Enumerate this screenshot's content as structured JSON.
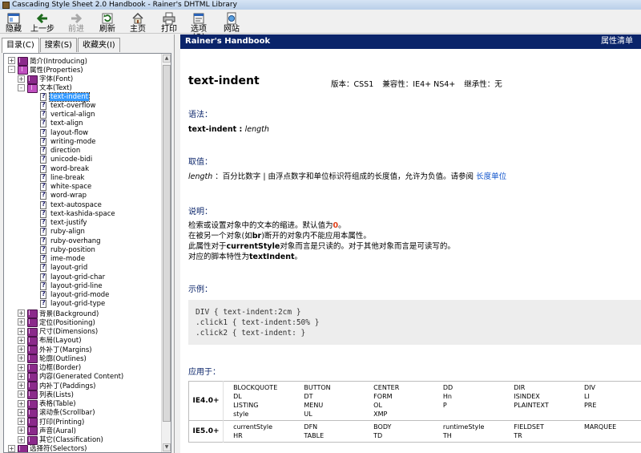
{
  "window": {
    "title": "Cascading Style Sheet 2.0 Handbook - Rainer's DHTML Library"
  },
  "toolbar": [
    {
      "id": "hide",
      "label": "隐藏",
      "icon": "hide-icon",
      "enabled": true
    },
    {
      "id": "back",
      "label": "上一步",
      "icon": "back-arrow-icon",
      "enabled": true
    },
    {
      "id": "forward",
      "label": "前进",
      "icon": "forward-arrow-icon",
      "enabled": false
    },
    {
      "id": "refresh",
      "label": "刷新",
      "icon": "refresh-icon",
      "enabled": true
    },
    {
      "id": "home",
      "label": "主页",
      "icon": "home-icon",
      "enabled": true
    },
    {
      "id": "print",
      "label": "打印",
      "icon": "printer-icon",
      "enabled": true
    },
    {
      "id": "options",
      "label": "选项(O)",
      "icon": "options-icon",
      "enabled": true
    },
    {
      "id": "web",
      "label": "网站",
      "icon": "web-icon",
      "enabled": true
    }
  ],
  "nav_tabs": [
    "目录(C)",
    "搜索(S)",
    "收藏夹(I)"
  ],
  "tree": [
    {
      "level": 0,
      "kind": "book",
      "expander": "+",
      "label": "简介(Introducing)"
    },
    {
      "level": 0,
      "kind": "book-open",
      "expander": "-",
      "label": "属性(Properties)"
    },
    {
      "level": 1,
      "kind": "book",
      "expander": "+",
      "label": "字体(Font)"
    },
    {
      "level": 1,
      "kind": "book-open",
      "expander": "-",
      "label": "文本(Text)"
    },
    {
      "level": 2,
      "kind": "page",
      "label": "text-indent",
      "selected": true
    },
    {
      "level": 2,
      "kind": "page",
      "label": "text-overflow"
    },
    {
      "level": 2,
      "kind": "page",
      "label": "vertical-align"
    },
    {
      "level": 2,
      "kind": "page",
      "label": "text-align"
    },
    {
      "level": 2,
      "kind": "page",
      "label": "layout-flow"
    },
    {
      "level": 2,
      "kind": "page",
      "label": "writing-mode"
    },
    {
      "level": 2,
      "kind": "page",
      "label": "direction"
    },
    {
      "level": 2,
      "kind": "page",
      "label": "unicode-bidi"
    },
    {
      "level": 2,
      "kind": "page",
      "label": "word-break"
    },
    {
      "level": 2,
      "kind": "page",
      "label": "line-break"
    },
    {
      "level": 2,
      "kind": "page",
      "label": "white-space"
    },
    {
      "level": 2,
      "kind": "page",
      "label": "word-wrap"
    },
    {
      "level": 2,
      "kind": "page",
      "label": "text-autospace"
    },
    {
      "level": 2,
      "kind": "page",
      "label": "text-kashida-space"
    },
    {
      "level": 2,
      "kind": "page",
      "label": "text-justify"
    },
    {
      "level": 2,
      "kind": "page",
      "label": "ruby-align"
    },
    {
      "level": 2,
      "kind": "page",
      "label": "ruby-overhang"
    },
    {
      "level": 2,
      "kind": "page",
      "label": "ruby-position"
    },
    {
      "level": 2,
      "kind": "page",
      "label": "ime-mode"
    },
    {
      "level": 2,
      "kind": "page",
      "label": "layout-grid"
    },
    {
      "level": 2,
      "kind": "page",
      "label": "layout-grid-char"
    },
    {
      "level": 2,
      "kind": "page",
      "label": "layout-grid-line"
    },
    {
      "level": 2,
      "kind": "page",
      "label": "layout-grid-mode"
    },
    {
      "level": 2,
      "kind": "page",
      "label": "layout-grid-type"
    },
    {
      "level": 1,
      "kind": "book",
      "expander": "+",
      "label": "背景(Background)"
    },
    {
      "level": 1,
      "kind": "book",
      "expander": "+",
      "label": "定位(Positioning)"
    },
    {
      "level": 1,
      "kind": "book",
      "expander": "+",
      "label": "尺寸(Dimensions)"
    },
    {
      "level": 1,
      "kind": "book",
      "expander": "+",
      "label": "布局(Layout)"
    },
    {
      "level": 1,
      "kind": "book",
      "expander": "+",
      "label": "外补丁(Margins)"
    },
    {
      "level": 1,
      "kind": "book",
      "expander": "+",
      "label": "轮廓(Outlines)"
    },
    {
      "level": 1,
      "kind": "book",
      "expander": "+",
      "label": "边框(Border)"
    },
    {
      "level": 1,
      "kind": "book",
      "expander": "+",
      "label": "内容(Generated Content)"
    },
    {
      "level": 1,
      "kind": "book",
      "expander": "+",
      "label": "内补丁(Paddings)"
    },
    {
      "level": 1,
      "kind": "book",
      "expander": "+",
      "label": "列表(Lists)"
    },
    {
      "level": 1,
      "kind": "book",
      "expander": "+",
      "label": "表格(Table)"
    },
    {
      "level": 1,
      "kind": "book",
      "expander": "+",
      "label": "滚动条(Scrollbar)"
    },
    {
      "level": 1,
      "kind": "book",
      "expander": "+",
      "label": "打印(Printing)"
    },
    {
      "level": 1,
      "kind": "book",
      "expander": "+",
      "label": "声音(Aural)"
    },
    {
      "level": 1,
      "kind": "book",
      "expander": "+",
      "label": "其它(Classification)"
    },
    {
      "level": 0,
      "kind": "book",
      "expander": "+",
      "label": "选择符(Selectors)"
    }
  ],
  "content": {
    "header": "Rainer's Handbook",
    "header_link": "属性清单",
    "title": "text-indent",
    "version": "版本：CSS1",
    "compat": "兼容性：IE4+ NS4+",
    "inherit": "继承性：无",
    "syntax_heading": "语法：",
    "syntax_prop": "text-indent",
    "syntax_sep": " : ",
    "syntax_value": "length",
    "values_heading": "取值：",
    "values_term": "length",
    "values_desc": " ：百分比数字 | 由浮点数字和单位标识符组成的长度值，允许为负值。请参阅",
    "values_link": "长度单位",
    "notes_heading": "说明：",
    "note1_pre": "检索或设置对象中的文本的缩进。默认值为",
    "note1_val": "0",
    "note1_post": "。",
    "note2_pre": "在被另一个对象(如",
    "note2_kw": "br",
    "note2_post": ")断开的对象内不能应用本属性。",
    "note3_pre": "此属性对于",
    "note3_kw": "currentStyle",
    "note3_post": "对象而言是只读的。对于其他对象而言是可读写的。",
    "note4_pre": "对应的脚本特性为",
    "note4_kw": "textIndent",
    "note4_post": "。",
    "example_heading": "示例：",
    "example_lines": [
      "DIV { text-indent:2cm }",
      ".click1 { text-indent:50% }",
      ".click2 { text-indent: }"
    ],
    "applies_heading": "应用于：",
    "applies": [
      {
        "browser": "IE4.0+",
        "rows": [
          [
            "BLOCKQUOTE",
            "BUTTON",
            "CENTER",
            "DD",
            "DIR",
            "DIV"
          ],
          [
            "DL",
            "DT",
            "FORM",
            "Hn",
            "ISINDEX",
            "LI"
          ],
          [
            "LISTING",
            "MENU",
            "OL",
            "P",
            "PLAINTEXT",
            "PRE"
          ],
          [
            "style",
            "UL",
            "XMP",
            "",
            "",
            ""
          ]
        ]
      },
      {
        "browser": "IE5.0+",
        "rows": [
          [
            "currentStyle",
            "DFN",
            "BODY",
            "runtimeStyle",
            "FIELDSET",
            "MARQUEE"
          ],
          [
            "HR",
            "TABLE",
            "TD",
            "TH",
            "TR",
            ""
          ]
        ]
      }
    ]
  },
  "colors": {
    "header_bg": "#0a246a",
    "selection": "#3399ff",
    "section_heading": "#0a246a",
    "link": "#1155cc",
    "default_value": "#e0401a"
  }
}
